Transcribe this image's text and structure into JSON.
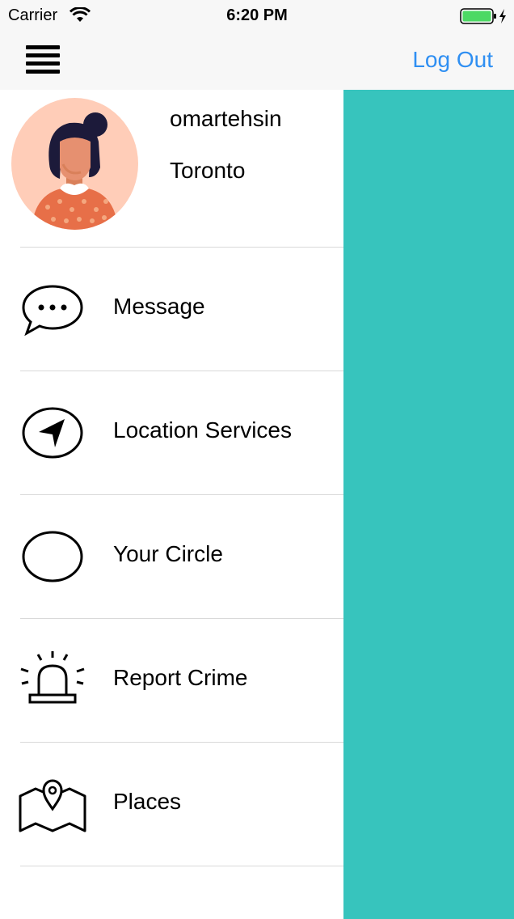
{
  "status_bar": {
    "carrier": "Carrier",
    "time": "6:20 PM"
  },
  "nav": {
    "logout_label": "Log Out"
  },
  "profile": {
    "username": "omartehsin",
    "city": "Toronto"
  },
  "menu": {
    "items": [
      {
        "label": "Message",
        "icon": "message-icon"
      },
      {
        "label": "Location Services",
        "icon": "location-arrow-icon"
      },
      {
        "label": "Your Circle",
        "icon": "circle-icon"
      },
      {
        "label": "Report Crime",
        "icon": "siren-icon"
      },
      {
        "label": "Places",
        "icon": "map-pin-icon"
      }
    ]
  },
  "colors": {
    "accent": "#2f8ff2",
    "overlay": "#37c4bd",
    "avatar_bg": "#ffcdb8"
  }
}
